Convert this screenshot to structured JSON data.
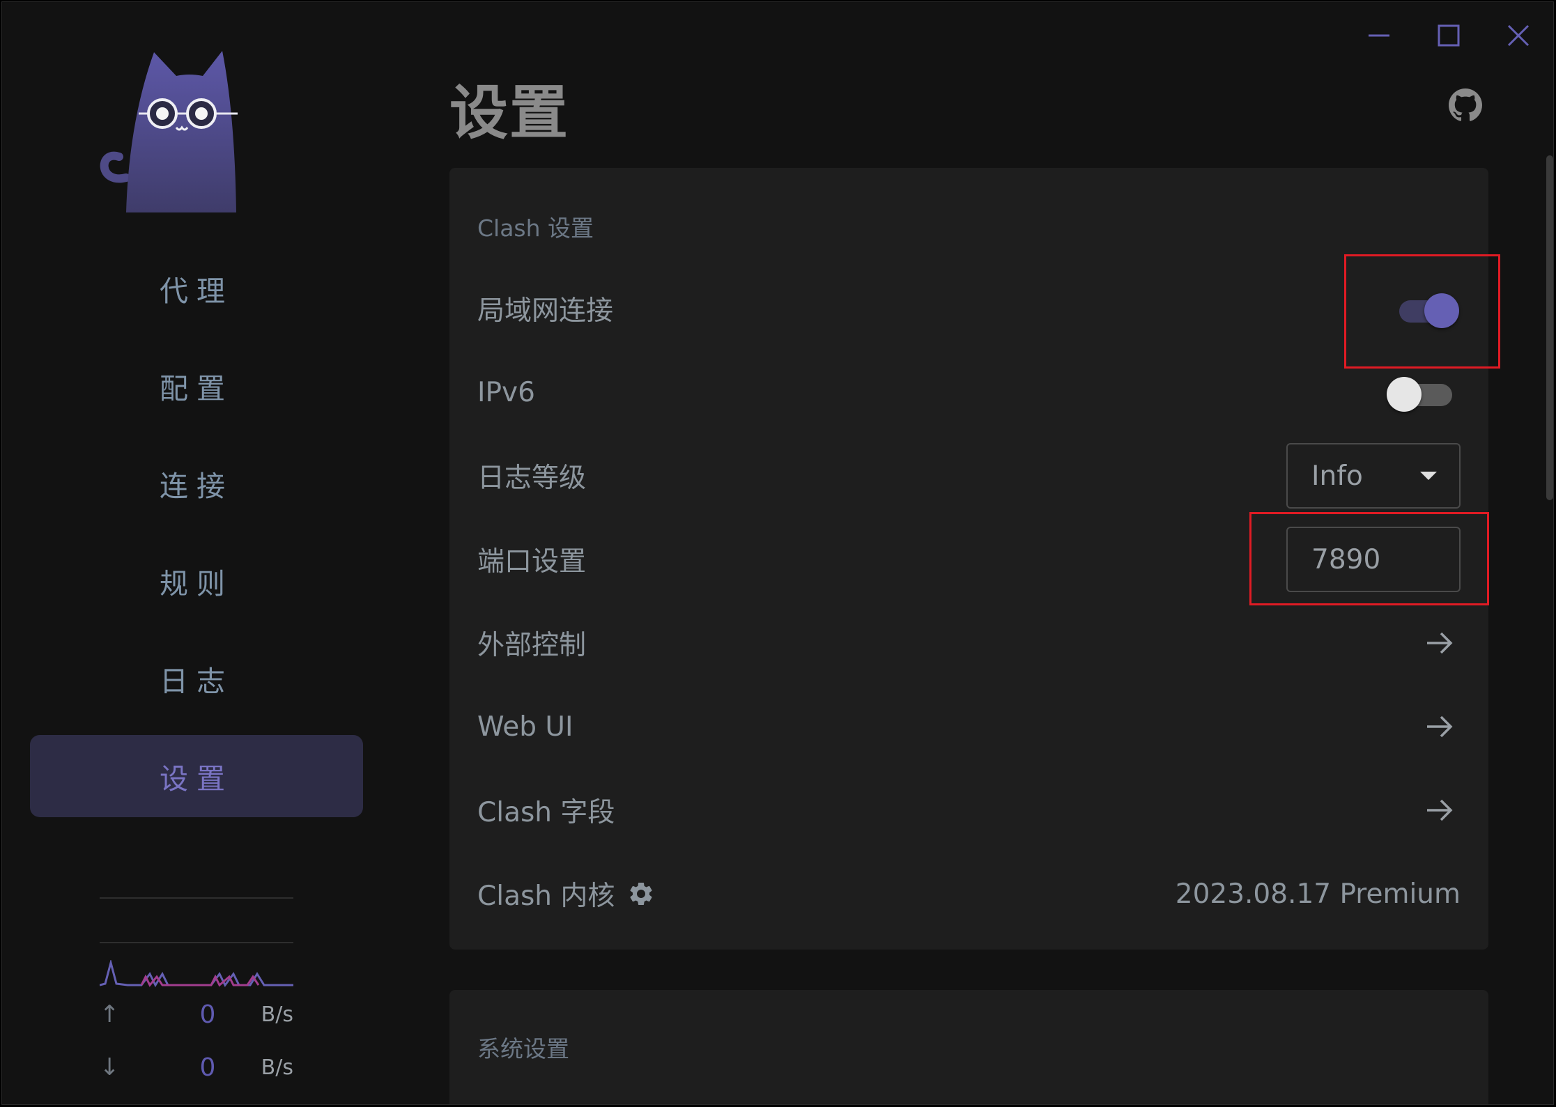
{
  "window": {
    "controls": [
      "minimize-icon",
      "maximize-icon",
      "close-icon"
    ],
    "accent": "#6560b4"
  },
  "sidebar": {
    "items": [
      {
        "label": "代理",
        "active": false
      },
      {
        "label": "配置",
        "active": false
      },
      {
        "label": "连接",
        "active": false
      },
      {
        "label": "规则",
        "active": false
      },
      {
        "label": "日志",
        "active": false
      },
      {
        "label": "设置",
        "active": true
      }
    ],
    "traffic": {
      "up": {
        "value": "0",
        "unit": "B/s"
      },
      "down": {
        "value": "0",
        "unit": "B/s"
      }
    }
  },
  "page": {
    "title": "设置"
  },
  "clash_settings": {
    "title": "Clash 设置",
    "lan": {
      "label": "局域网连接",
      "enabled": true
    },
    "ipv6": {
      "label": "IPv6",
      "enabled": false
    },
    "log_level": {
      "label": "日志等级",
      "value": "Info"
    },
    "port": {
      "label": "端口设置",
      "value": "7890"
    },
    "external_control": {
      "label": "外部控制"
    },
    "web_ui": {
      "label": "Web UI"
    },
    "clash_field": {
      "label": "Clash 字段"
    },
    "core": {
      "label": "Clash 内核",
      "version": "2023.08.17 Premium"
    }
  },
  "system_settings": {
    "title": "系统设置"
  },
  "annotations": {
    "highlight_color": "#e01b24"
  }
}
